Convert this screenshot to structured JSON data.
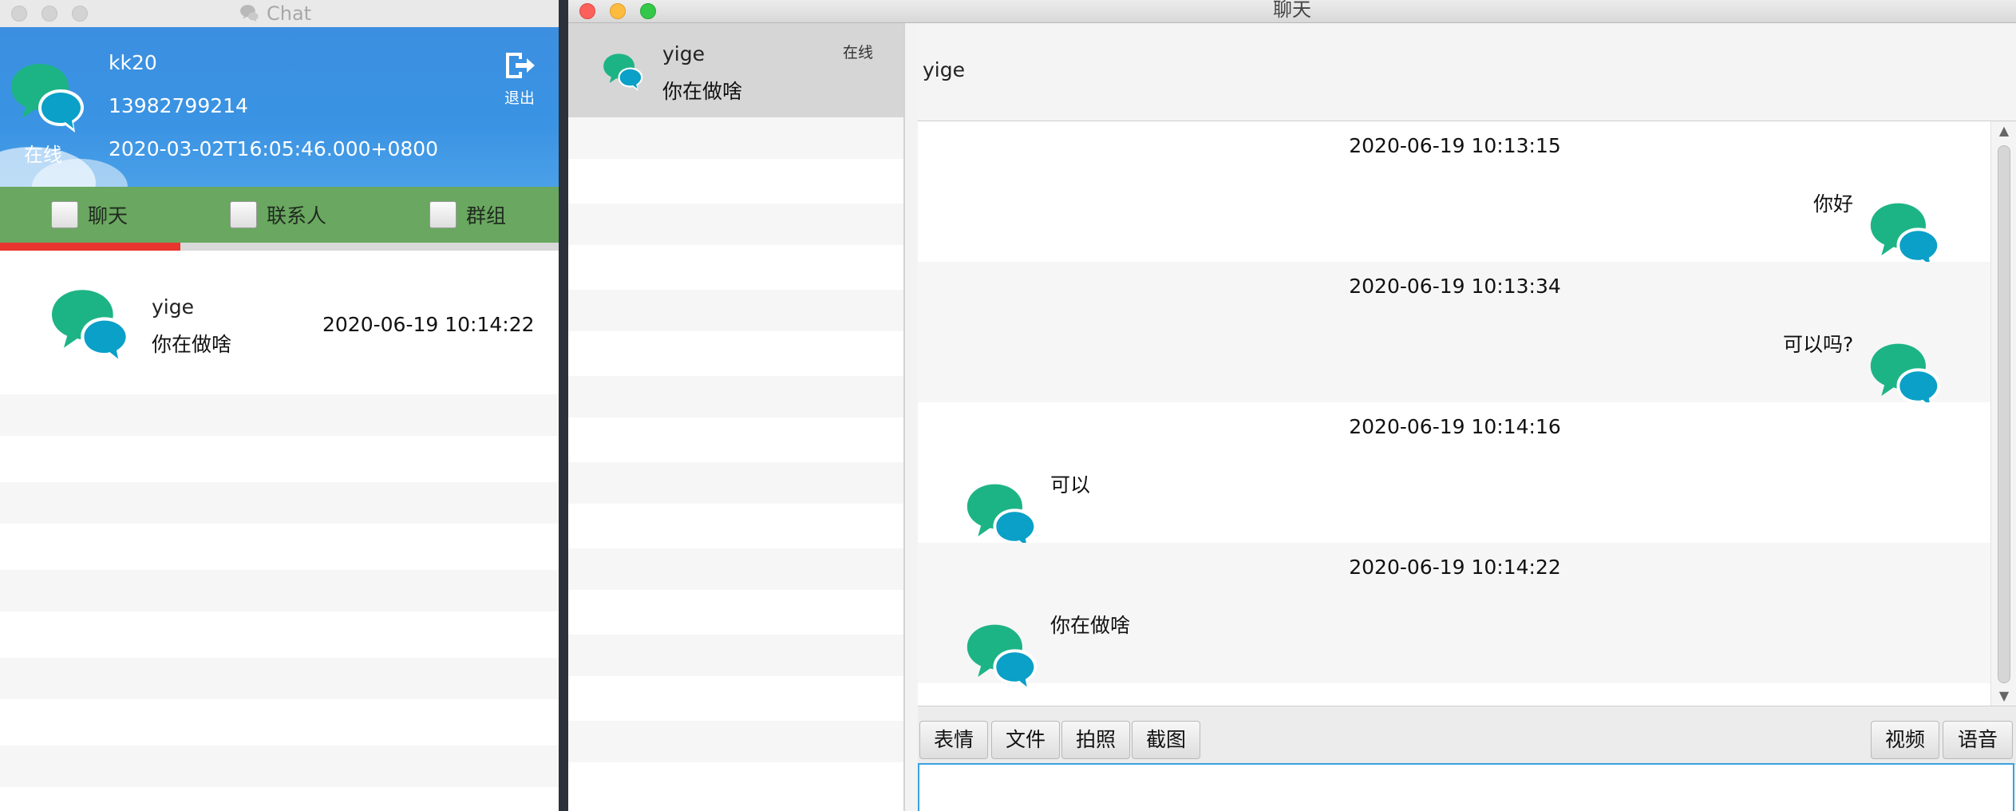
{
  "left_window": {
    "title": "Chat",
    "profile": {
      "username": "kk20",
      "phone": "13982799214",
      "timestamp": "2020-03-02T16:05:46.000+0800",
      "status": "在线",
      "logout_label": "退出"
    },
    "tabs": [
      {
        "label": "聊天",
        "selected": true
      },
      {
        "label": "联系人",
        "selected": false
      },
      {
        "label": "群组",
        "selected": false
      }
    ],
    "conversations": [
      {
        "name": "yige",
        "last_message": "你在做啥",
        "time": "2020-06-19 10:14:22"
      }
    ]
  },
  "right_window": {
    "title": "聊天",
    "friends": [
      {
        "name": "yige",
        "last_message": "你在做啥",
        "status": "在线"
      }
    ],
    "chat": {
      "contact_name": "yige",
      "messages": [
        {
          "time": "2020-06-19 10:13:15",
          "text": "你好",
          "direction": "outgoing"
        },
        {
          "time": "2020-06-19 10:13:34",
          "text": "可以吗?",
          "direction": "outgoing"
        },
        {
          "time": "2020-06-19 10:14:16",
          "text": "可以",
          "direction": "incoming"
        },
        {
          "time": "2020-06-19 10:14:22",
          "text": "你在做啥",
          "direction": "incoming"
        }
      ]
    },
    "toolbar": {
      "emoji": "表情",
      "file": "文件",
      "photo": "拍照",
      "screenshot": "截图",
      "video": "视频",
      "voice": "语音"
    },
    "input": {
      "value": ""
    }
  },
  "colors": {
    "bubble_green": "#1db485",
    "bubble_blue": "#0aa0c7",
    "tab_bar": "#6aa760",
    "active_tab_indicator": "#e8352e",
    "profile_bg": "#3c8fe0",
    "input_focus": "#3aa1df"
  },
  "icons": {
    "app": "chat-bubbles-icon",
    "logout": "logout-icon",
    "avatar": "chat-bubbles-avatar-icon"
  }
}
